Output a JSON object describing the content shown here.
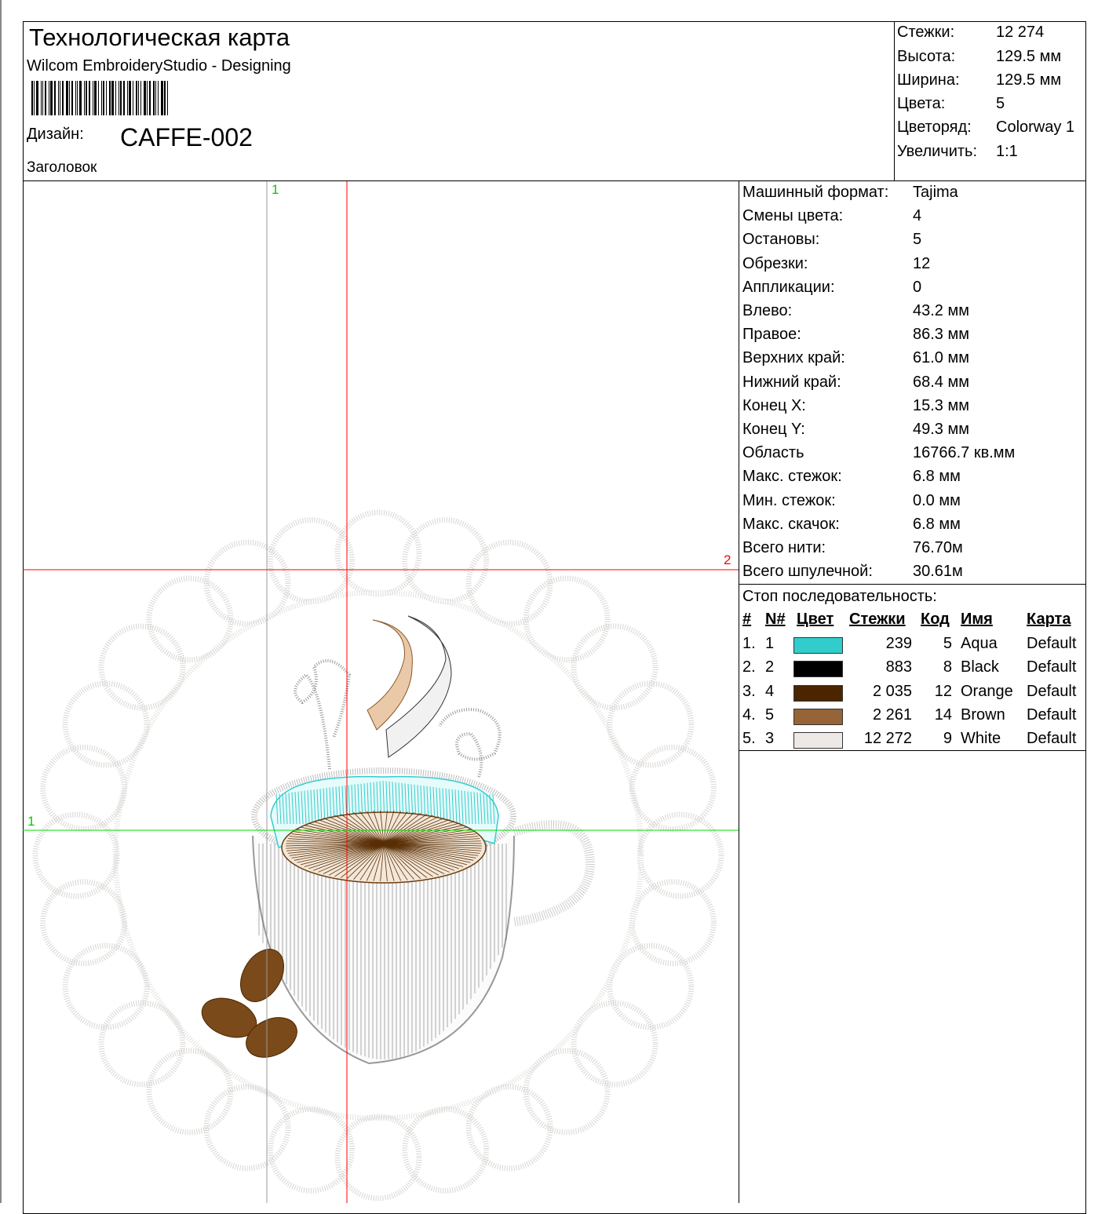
{
  "header": {
    "title": "Технологическая карта",
    "subtitle": "Wilcom EmbroideryStudio - Designing",
    "design_label": "Дизайн:",
    "design_name": "CAFFE-002",
    "heading_label": "Заголовок"
  },
  "summary": [
    {
      "label": "Стежки:",
      "value": "12 274"
    },
    {
      "label": "Высота:",
      "value": "129.5 мм"
    },
    {
      "label": "Ширина:",
      "value": "129.5 мм"
    },
    {
      "label": "Цвета:",
      "value": "5"
    },
    {
      "label": "Цветоряд:",
      "value": "Colorway 1"
    },
    {
      "label": "Увеличить:",
      "value": "1:1"
    }
  ],
  "stats": [
    {
      "label": "Машинный формат:",
      "value": "Tajima"
    },
    {
      "label": "Смены цвета:",
      "value": "4"
    },
    {
      "label": "Остановы:",
      "value": "5"
    },
    {
      "label": "Обрезки:",
      "value": "12"
    },
    {
      "label": "Аппликации:",
      "value": "0"
    },
    {
      "label": "Влево:",
      "value": "43.2 мм"
    },
    {
      "label": "Правое:",
      "value": "86.3 мм"
    },
    {
      "label": "Верхних край:",
      "value": "61.0 мм"
    },
    {
      "label": "Нижний край:",
      "value": "68.4 мм"
    },
    {
      "label": "Конец X:",
      "value": "15.3 мм"
    },
    {
      "label": "Конец Y:",
      "value": "49.3 мм"
    },
    {
      "label": "Область",
      "value": "16766.7 кв.мм"
    },
    {
      "label": "Макс. стежок:",
      "value": "6.8 мм"
    },
    {
      "label": "Мин. стежок:",
      "value": "0.0 мм"
    },
    {
      "label": "Макс. скачок:",
      "value": "6.8 мм"
    },
    {
      "label": "Всего нити:",
      "value": "76.70м"
    },
    {
      "label": "Всего шпулечной:",
      "value": "30.61м"
    }
  ],
  "stop_sequence": {
    "title": "Стоп последовательность:",
    "columns": [
      "#",
      "N#",
      "Цвет",
      "Стежки",
      "Код",
      "Имя",
      "Карта"
    ],
    "rows": [
      {
        "idx": "1.",
        "n": "1",
        "color": "#33CCCC",
        "stitches": "239",
        "code": "5",
        "name": "Aqua",
        "chart": "Default"
      },
      {
        "idx": "2.",
        "n": "2",
        "color": "#000000",
        "stitches": "883",
        "code": "8",
        "name": "Black",
        "chart": "Default"
      },
      {
        "idx": "3.",
        "n": "4",
        "color": "#4A2500",
        "stitches": "2 035",
        "code": "12",
        "name": "Orange",
        "chart": "Default"
      },
      {
        "idx": "4.",
        "n": "5",
        "color": "#966436",
        "stitches": "2 261",
        "code": "14",
        "name": "Brown",
        "chart": "Default"
      },
      {
        "idx": "5.",
        "n": "3",
        "color": "#ECE9E6",
        "stitches": "12 272",
        "code": "9",
        "name": "White",
        "chart": "Default"
      }
    ]
  },
  "design_markers": {
    "vertical_1": "1",
    "horizontal_2": "2",
    "horizontal_1": "1"
  }
}
